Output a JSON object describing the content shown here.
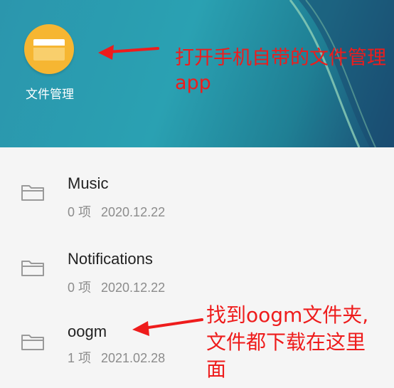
{
  "home": {
    "app_label": "文件管理",
    "annotation": "打开手机自带的文件管理app"
  },
  "files": [
    {
      "name": "Music",
      "count": "0 项",
      "date": "2020.12.22"
    },
    {
      "name": "Notifications",
      "count": "0 项",
      "date": "2020.12.22"
    },
    {
      "name": "oogm",
      "count": "1 项",
      "date": "2021.02.28"
    }
  ],
  "annotation_folder": "找到oogm文件夹,文件都下载在这里面",
  "colors": {
    "annotation": "#ee1c1c",
    "app_icon": "#f6b632",
    "meta_text": "#8c8c8c"
  }
}
